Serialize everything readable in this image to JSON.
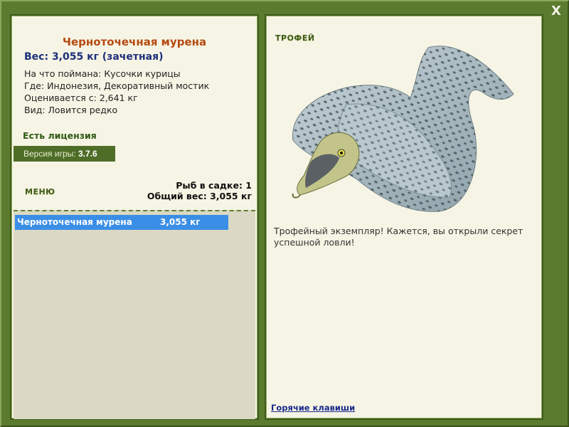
{
  "window": {
    "close_label": "X"
  },
  "fish": {
    "title": "Черноточечная мурена",
    "weight_line": "Вес: 3,055 кг (зачетная)",
    "bait_line": "На что поймана: Кусочки курицы",
    "location_line": "Где: Индонезия, Декоративный мостик",
    "rated_line": "Оценивается с: 2,641 кг",
    "rarity_line": "Вид: Ловится редко"
  },
  "license_text": "Есть лицензия",
  "version": {
    "label": "Версия игры:",
    "value": "3.7.6"
  },
  "menu_label": "МЕНЮ",
  "keepnet": {
    "count_line": "Рыб в садке: 1",
    "total_line": "Общий вес: 3,055 кг"
  },
  "catch_list": [
    {
      "name": "Черноточечная мурена",
      "weight": "3,055 кг"
    }
  ],
  "trophy": {
    "label": "ТРОФЕЙ",
    "text": "Трофейный экземпляр! Кажется, вы открыли секрет успешной ловли!",
    "image_icon": "moray-eel-image"
  },
  "hotkeys_label": "Горячие клавиши",
  "colors": {
    "frame": "#5b7b2f",
    "panel": "#f6f4e4",
    "title": "#b54a12",
    "weight": "#1e2f7a",
    "selection": "#3a8ee6"
  }
}
